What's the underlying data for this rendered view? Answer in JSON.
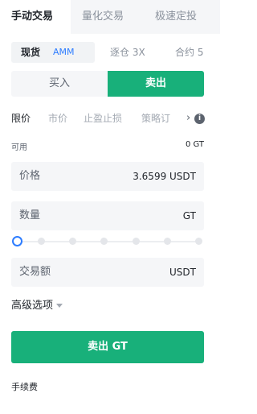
{
  "top_tabs": [
    "手动交易",
    "量化交易",
    "极速定投"
  ],
  "sub_tabs": {
    "spot_label": "现货",
    "spot_badge": "AMM",
    "margin": "逐仓 3X",
    "contract": "合约 5"
  },
  "side": {
    "buy": "买入",
    "sell": "卖出"
  },
  "order_types": [
    "限价",
    "市价",
    "止盈止损",
    "策略订"
  ],
  "info_icon_glyph": "i",
  "available": {
    "label": "可用",
    "value": "0 GT"
  },
  "price": {
    "label": "价格",
    "value": "3.6599 USDT"
  },
  "amount": {
    "label": "数量",
    "value": "GT"
  },
  "slider": {
    "value_percent": 0,
    "marks": [
      0,
      16.7,
      33.3,
      50,
      66.7,
      83.3,
      100
    ]
  },
  "total": {
    "label": "交易额",
    "value": "USDT"
  },
  "advanced_label": "高级选项",
  "submit_label": "卖出 GT",
  "fee_label": "手续费",
  "colors": {
    "sell_green": "#18b07a",
    "accent_blue": "#2e7dff"
  }
}
